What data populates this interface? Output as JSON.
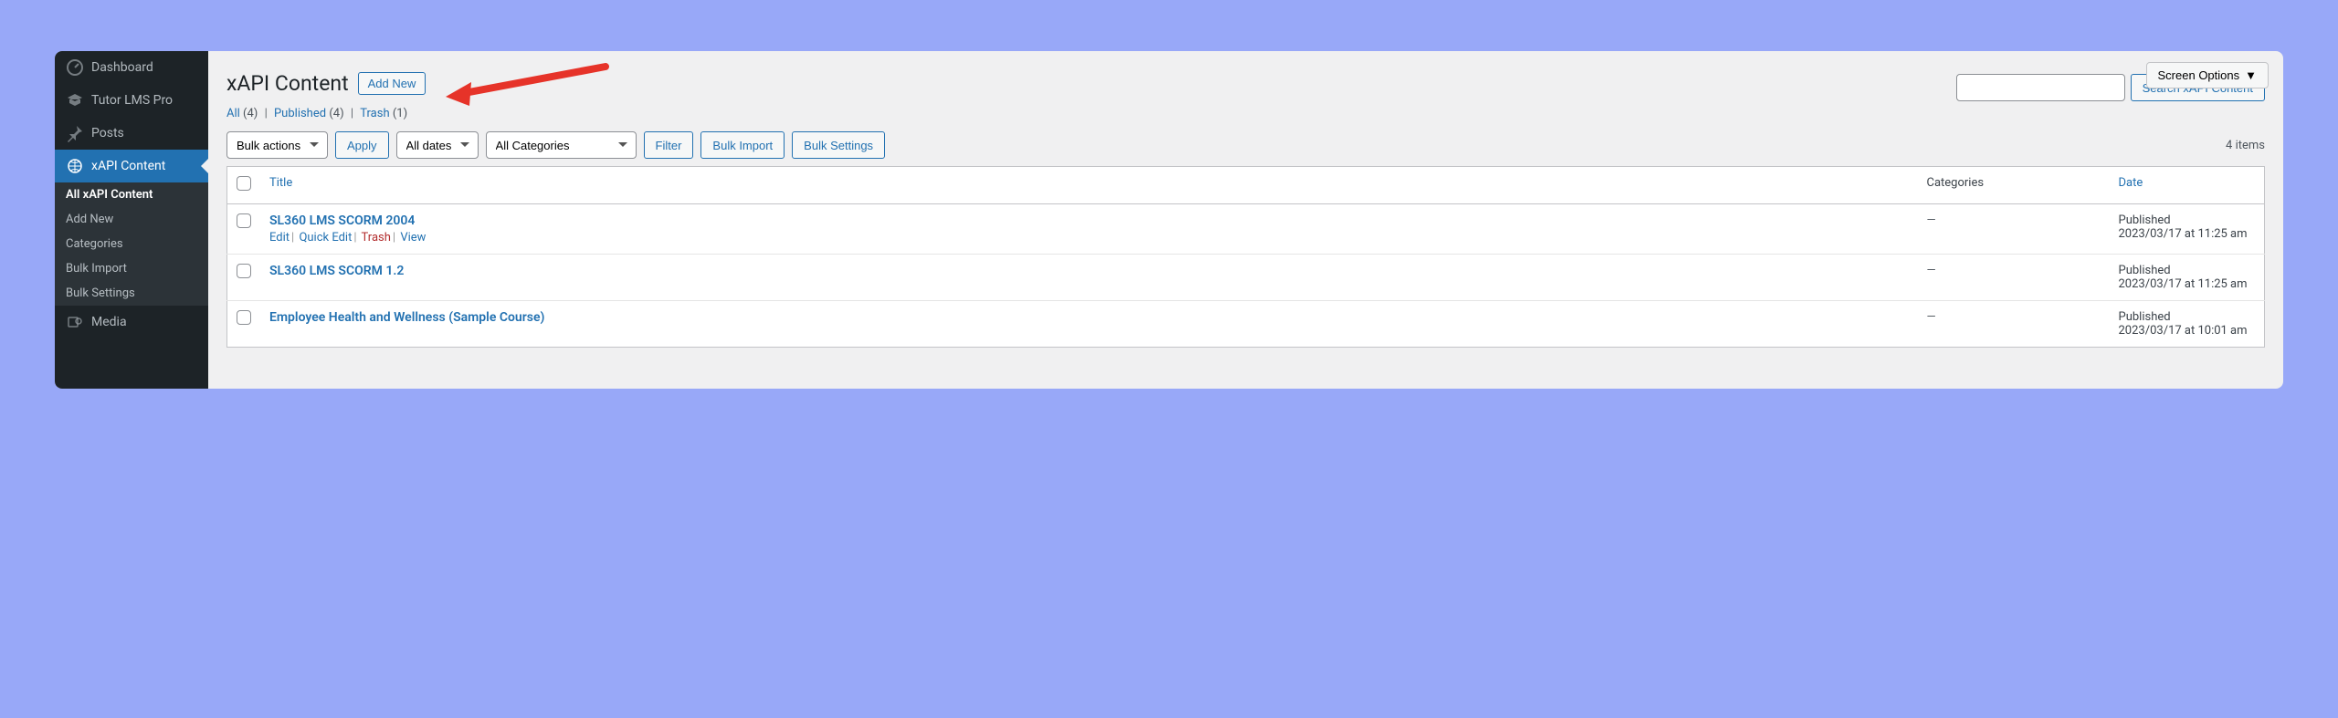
{
  "sidebar": {
    "items": [
      {
        "icon": "dashboard",
        "label": "Dashboard"
      },
      {
        "icon": "tutor",
        "label": "Tutor LMS Pro"
      },
      {
        "icon": "pin",
        "label": "Posts"
      },
      {
        "icon": "globe",
        "label": "xAPI Content"
      },
      {
        "icon": "media",
        "label": "Media"
      }
    ],
    "submenu": [
      "All xAPI Content",
      "Add New",
      "Categories",
      "Bulk Import",
      "Bulk Settings"
    ]
  },
  "screen_options": "Screen Options",
  "page_title": "xAPI Content",
  "add_new": "Add New",
  "filters": {
    "all": {
      "label": "All",
      "count": "(4)"
    },
    "published": {
      "label": "Published",
      "count": "(4)"
    },
    "trash": {
      "label": "Trash",
      "count": "(1)"
    }
  },
  "controls": {
    "bulk_actions": "Bulk actions",
    "apply": "Apply",
    "all_dates": "All dates",
    "all_categories": "All Categories",
    "filter": "Filter",
    "bulk_import": "Bulk Import",
    "bulk_settings": "Bulk Settings",
    "search": "Search xAPI Content",
    "items_count": "4 items"
  },
  "table": {
    "headers": {
      "title": "Title",
      "categories": "Categories",
      "date": "Date"
    },
    "rows": [
      {
        "title": "SL360 LMS SCORM 2004",
        "actions": {
          "edit": "Edit",
          "quick_edit": "Quick Edit",
          "trash": "Trash",
          "view": "View"
        },
        "category": "—",
        "status": "Published",
        "date": "2023/03/17 at 11:25 am",
        "show_actions": true
      },
      {
        "title": "SL360 LMS SCORM 1.2",
        "category": "—",
        "status": "Published",
        "date": "2023/03/17 at 11:25 am",
        "show_actions": false
      },
      {
        "title": "Employee Health and Wellness (Sample Course)",
        "category": "—",
        "status": "Published",
        "date": "2023/03/17 at 10:01 am",
        "show_actions": false
      }
    ]
  }
}
